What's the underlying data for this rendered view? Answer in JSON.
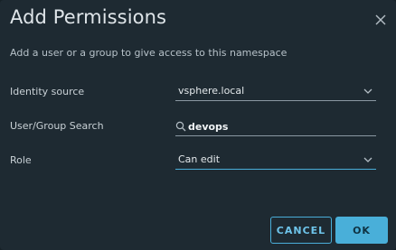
{
  "dialog": {
    "title": "Add Permissions",
    "subtitle": "Add a user or a group to give access to this namespace"
  },
  "form": {
    "identity_source": {
      "label": "Identity source",
      "value": "vsphere.local"
    },
    "search": {
      "label": "User/Group Search",
      "value": "devops"
    },
    "role": {
      "label": "Role",
      "value": "Can edit"
    }
  },
  "footer": {
    "cancel_label": "CANCEL",
    "ok_label": "OK"
  },
  "colors": {
    "accent": "#49afd9",
    "background": "#1e2a32"
  },
  "icons": {
    "close": "close-icon",
    "search": "search-icon",
    "dropdown": "chevron-down-icon"
  }
}
